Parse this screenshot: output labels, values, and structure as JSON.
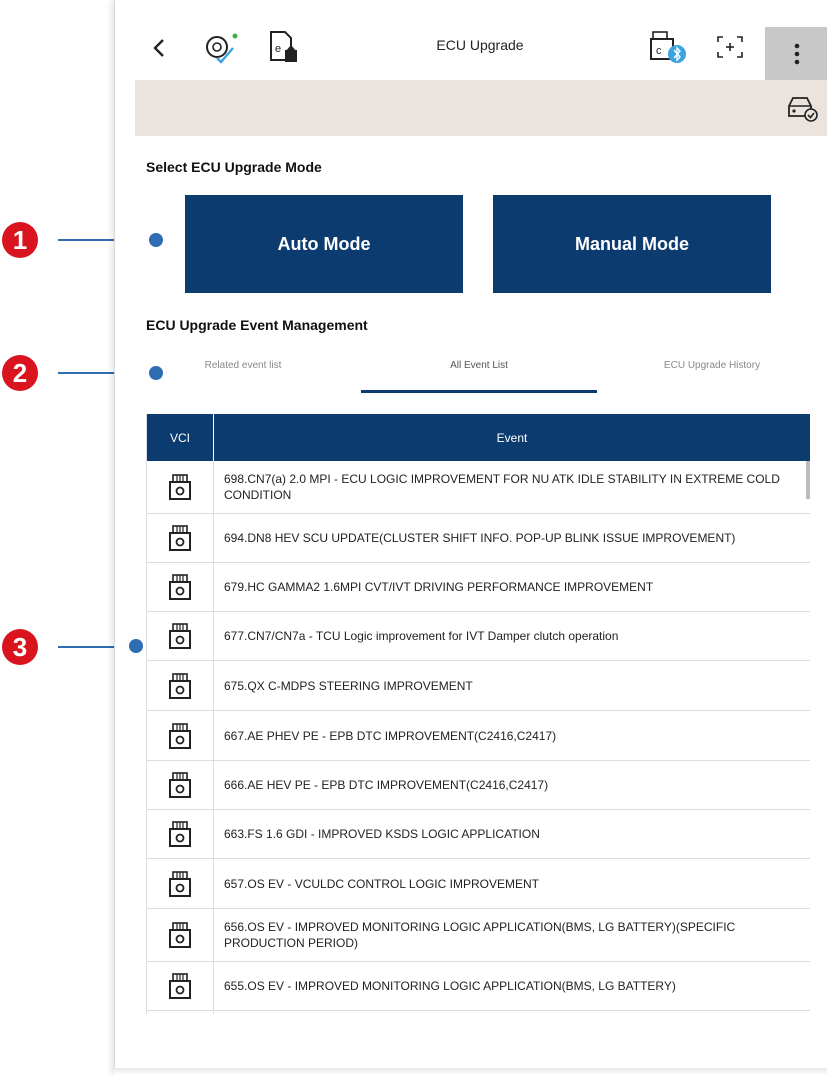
{
  "header": {
    "title": "ECU Upgrade"
  },
  "mode_section": {
    "title": "Select ECU Upgrade Mode",
    "auto_label": "Auto Mode",
    "manual_label": "Manual Mode"
  },
  "event_section": {
    "title": "ECU Upgrade Event Management",
    "tabs": [
      {
        "label": "Related event list"
      },
      {
        "label": "All Event List"
      },
      {
        "label": "ECU Upgrade History"
      }
    ],
    "selected_tab": "All Event List"
  },
  "table": {
    "headers": {
      "vci": "VCI",
      "event": "Event"
    },
    "rows": [
      {
        "event": "698.CN7(a) 2.0 MPI - ECU LOGIC IMPROVEMENT FOR NU ATK IDLE STABILITY IN EXTREME COLD CONDITION"
      },
      {
        "event": "694.DN8 HEV SCU UPDATE(CLUSTER SHIFT INFO. POP-UP BLINK ISSUE IMPROVEMENT)"
      },
      {
        "event": "679.HC GAMMA2 1.6MPI CVT/IVT DRIVING PERFORMANCE IMPROVEMENT"
      },
      {
        "event": "677.CN7/CN7a - TCU Logic improvement for IVT Damper clutch operation"
      },
      {
        "event": "675.QX C-MDPS STEERING IMPROVEMENT"
      },
      {
        "event": "667.AE PHEV PE - EPB DTC IMPROVEMENT(C2416,C2417)"
      },
      {
        "event": "666.AE HEV PE - EPB DTC IMPROVEMENT(C2416,C2417)"
      },
      {
        "event": "663.FS 1.6 GDI - IMPROVED KSDS LOGIC APPLICATION"
      },
      {
        "event": "657.OS EV - VCULDC CONTROL LOGIC IMPROVEMENT"
      },
      {
        "event": "656.OS EV - IMPROVED MONITORING LOGIC APPLICATION(BMS, LG BATTERY)(SPECIFIC PRODUCTION PERIOD)"
      },
      {
        "event": "655.OS EV - IMPROVED MONITORING LOGIC APPLICATION(BMS, LG BATTERY)"
      },
      {
        "event": ""
      }
    ]
  },
  "callouts": [
    "1",
    "2",
    "3"
  ],
  "colors": {
    "primary": "#0c3b70",
    "subbar": "#ebe4de",
    "callout_badge": "#d9141e",
    "callout_line": "#2e6db1"
  }
}
